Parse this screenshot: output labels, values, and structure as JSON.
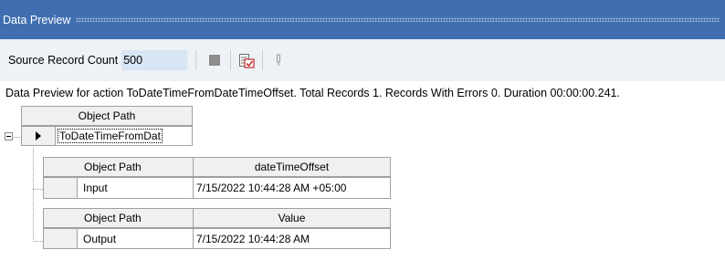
{
  "panel": {
    "title": "Data Preview"
  },
  "toolbar": {
    "source_record_count_label": "Source Record Count",
    "source_record_count_value": "500",
    "icons": [
      "stop-icon",
      "preview-grid-icon",
      "pin-icon"
    ]
  },
  "status_text": "Data Preview for action ToDateTimeFromDateTimeOffset. Total Records 1. Records With Errors 0. Duration 00:00:00.241.",
  "outer_grid": {
    "header": "Object Path",
    "row_value": "ToDateTimeFromDat"
  },
  "input_grid": {
    "headers": [
      "Object Path",
      "dateTimeOffset"
    ],
    "row": [
      "Input",
      "7/15/2022 10:44:28 AM +05:00"
    ]
  },
  "output_grid": {
    "headers": [
      "Object Path",
      "Value"
    ],
    "row": [
      "Output",
      "7/15/2022 10:44:28 AM"
    ]
  },
  "colors": {
    "titlebar": "#3f6fb0",
    "toolbar": "#eef1f6",
    "input_bg": "#d7e5f4",
    "header_bg": "#f0f0f0",
    "grid_border": "#a0a0a0"
  }
}
